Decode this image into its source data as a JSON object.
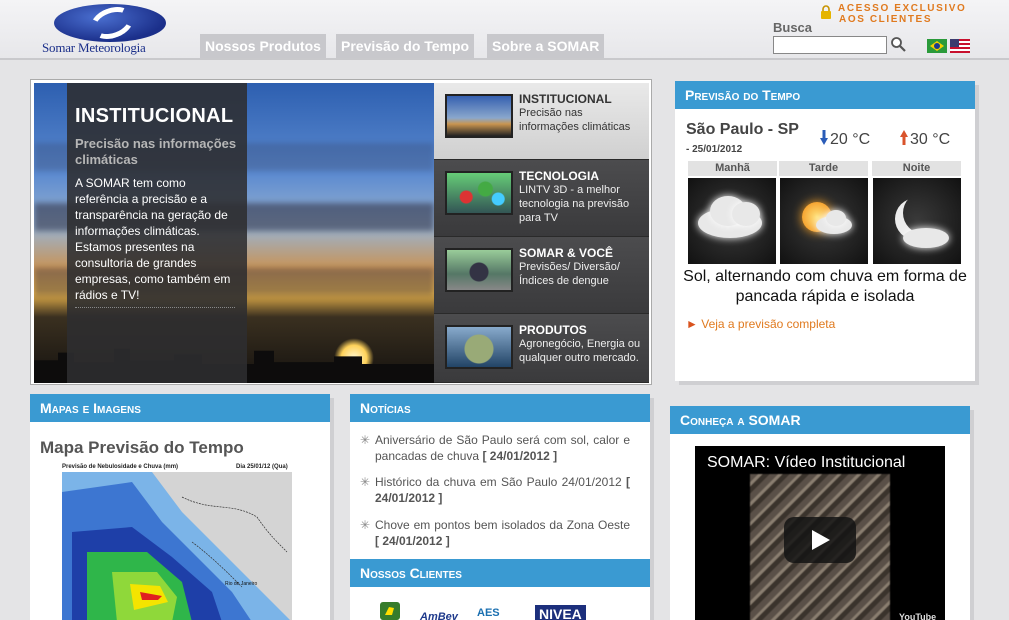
{
  "header": {
    "logo_text": "Somar Meteorologia",
    "nav": [
      "Nossos Produtos",
      "Previsão do Tempo",
      "Sobre a SOMAR"
    ],
    "acesso_line1": "ACESSO EXCLUSIVO",
    "acesso_line2": "AOS CLIENTES",
    "busca_label": "Busca",
    "busca_value": ""
  },
  "slider": {
    "title": "INSTITUCIONAL",
    "subtitle": "Precisão nas informações climáticas",
    "text": "A SOMAR tem como referência a precisão e a transparência na geração de informações climáticas. Estamos presentes na consultoria de grandes empresas, como também em rádios e TV!",
    "items": [
      {
        "title": "INSTITUCIONAL",
        "text": "Precisão nas informações climáticas"
      },
      {
        "title": "TECNOLOGIA",
        "text": "LINTV 3D - a melhor tecnologia na previsão para TV"
      },
      {
        "title": "SOMAR & VOCÊ",
        "text": "Previsões/ Diversão/ Índices de dengue"
      },
      {
        "title": "PRODUTOS",
        "text": "Agronegócio, Energia ou qualquer outro mercado."
      }
    ]
  },
  "weather": {
    "header": "Previsão do Tempo",
    "city": "São Paulo - SP",
    "date": "- 25/01/2012",
    "t_min": "20 °C",
    "t_max": "30 °C",
    "periods": [
      "Manhã",
      "Tarde",
      "Noite"
    ],
    "description": "Sol, alternando com chuva em forma de pancada rápida e isolada",
    "more_link": "Veja a previsão completa"
  },
  "maps": {
    "header": "Mapas e Imagens",
    "title": "Mapa Previsão do Tempo",
    "caption_left": "Previsão de Nebulosidade e Chuva (mm)",
    "caption_right": "Dia 25/01/12 (Qua)"
  },
  "news": {
    "header": "Notícias",
    "items": [
      {
        "text": "Aniversário de São Paulo será com sol, calor e pancadas de chuva",
        "date": "[ 24/01/2012 ]"
      },
      {
        "text": "Histórico da chuva em São Paulo 24/01/2012",
        "date": "[ 24/01/2012 ]"
      },
      {
        "text": "Chove em pontos bem isolados da Zona Oeste",
        "date": "[ 24/01/2012 ]"
      }
    ]
  },
  "clients": {
    "header": "Nossos Clientes",
    "logos": [
      "AmBev",
      "AES",
      "NIVEA"
    ]
  },
  "video": {
    "header": "Conheça a SOMAR",
    "title": "SOMAR: Vídeo Institucional",
    "brand": "YouTube"
  },
  "colors": {
    "accent": "#3a9ad2",
    "orange": "#e07a1f",
    "nav_bg": "#c8c8cc"
  }
}
